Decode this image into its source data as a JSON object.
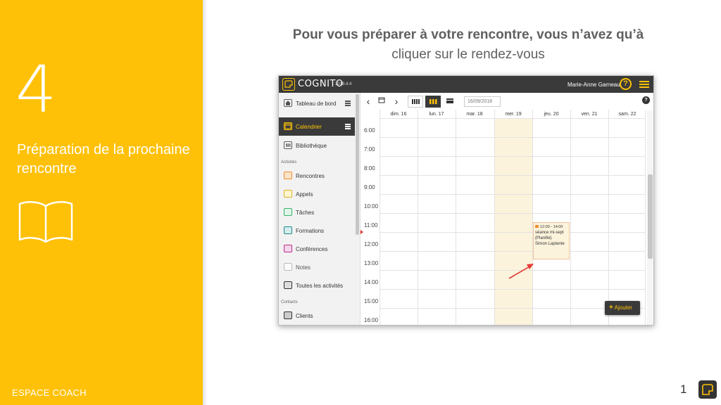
{
  "slide": {
    "step_number": "4",
    "step_title": "Préparation de la prochaine rencontre",
    "footer_brand": "ESPACE COACH",
    "page_number": "1",
    "headline_bold": "Pour vous préparer à votre rencontre, vous n’avez qu’à",
    "headline_light": "cliquer sur le rendez-vous",
    "accent_color": "#FFC107"
  },
  "app": {
    "name": "COGNITO",
    "version": "2018.4.4",
    "user": "Marie-Anne Garneau",
    "help_label": "?",
    "sidebar": {
      "items": [
        {
          "label": "Tableau de bord",
          "icon": "home-icon"
        },
        {
          "label": "Calendrier",
          "icon": "calendar-icon"
        },
        {
          "label": "Bibliothèque",
          "icon": "library-icon"
        }
      ],
      "section_activities": "Activités",
      "activities": [
        {
          "label": "Rencontres",
          "icon": "meeting-icon",
          "color": "#f08c2c"
        },
        {
          "label": "Appels",
          "icon": "phone-icon",
          "color": "#e0b020"
        },
        {
          "label": "Tâches",
          "icon": "tasks-icon",
          "color": "#3cb371"
        },
        {
          "label": "Formations",
          "icon": "training-icon",
          "color": "#1e8a8a"
        },
        {
          "label": "Conférences",
          "icon": "megaphone-icon",
          "color": "#c02b8a"
        },
        {
          "label": "Notes",
          "icon": "note-icon",
          "color": "#bbbbbb"
        },
        {
          "label": "Toutes les activités",
          "icon": "all-activities-icon",
          "color": "#333333"
        }
      ],
      "section_contacts": "Contacts",
      "contacts": [
        {
          "label": "Clients",
          "icon": "user-icon"
        }
      ]
    },
    "toolbar": {
      "prev": "‹",
      "next": "›",
      "date_value": "16/09/2018",
      "help": "?"
    },
    "calendar": {
      "days": [
        "dim. 16",
        "lun. 17",
        "mar. 18",
        "mer. 19",
        "jeu. 20",
        "ven. 21",
        "sam. 22"
      ],
      "hours": [
        "6:00",
        "7:00",
        "8:00",
        "9:00",
        "10:00",
        "11:00",
        "12:00",
        "13:00",
        "14:00",
        "15:00",
        "16:00"
      ],
      "event": {
        "time": "12:00 - 14:00",
        "title": "séance mi-sept",
        "status": "(Planifié)",
        "person": "Simon Laplante"
      },
      "add_button": "Ajouter"
    }
  }
}
